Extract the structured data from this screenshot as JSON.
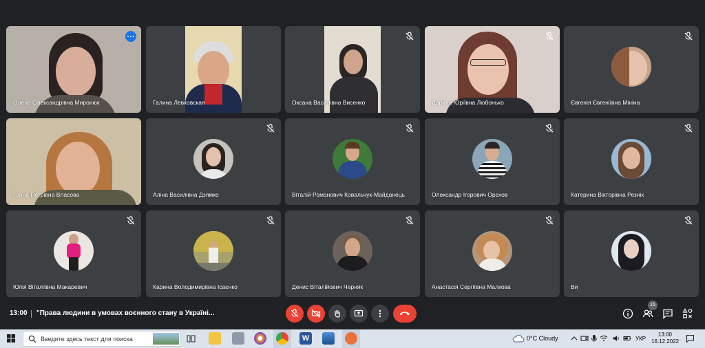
{
  "participants": [
    {
      "name": "Олена Олександрівна Миронюк",
      "muted": false,
      "active": true
    },
    {
      "name": "Галина Левковская",
      "muted": false
    },
    {
      "name": "Оксана Василівна Висенко",
      "muted": true
    },
    {
      "name": "Дарина Юріївна Любонько",
      "muted": true
    },
    {
      "name": "Євгенія Євгеніївна Мініна",
      "muted": true
    },
    {
      "name": "Ганна Петрівна Власова",
      "muted": false
    },
    {
      "name": "Аліна Василівна Дзямко",
      "muted": true
    },
    {
      "name": "Віталій Романович Ковальчук-Майданець",
      "muted": true
    },
    {
      "name": "Олександр Ігорович Орєхов",
      "muted": true
    },
    {
      "name": "Катерина Вікторівна Резнік",
      "muted": true
    },
    {
      "name": "Юлія Віталіївна Макаревич",
      "muted": true
    },
    {
      "name": "Карина Володимирівна Ісаєнко",
      "muted": true
    },
    {
      "name": "Денис Віталійович Черняк",
      "muted": true
    },
    {
      "name": "Анастасія Сергіївна Малкова",
      "muted": true
    },
    {
      "name": "Ви",
      "muted": true
    }
  ],
  "meeting": {
    "time": "13:00",
    "title": "\"Права людини в умовах воєнного стану в Україні...",
    "participant_count": "15"
  },
  "controls": [
    "mic-off",
    "camera-off",
    "raise-hand",
    "present",
    "more-options",
    "leave-call"
  ],
  "right_controls": [
    "meeting-details",
    "people",
    "chat",
    "activities"
  ],
  "taskbar": {
    "search_placeholder": "Введите здесь текст для поиска",
    "weather": "0°C  Cloudy",
    "language": "УКР",
    "clock_time": "13:00",
    "clock_date": "16.12.2022"
  },
  "colors": {
    "background": "#202124",
    "tile": "#3c4043",
    "accent": "#1a73e8",
    "danger": "#ea4335",
    "active_outline": "#8ab4f8"
  }
}
